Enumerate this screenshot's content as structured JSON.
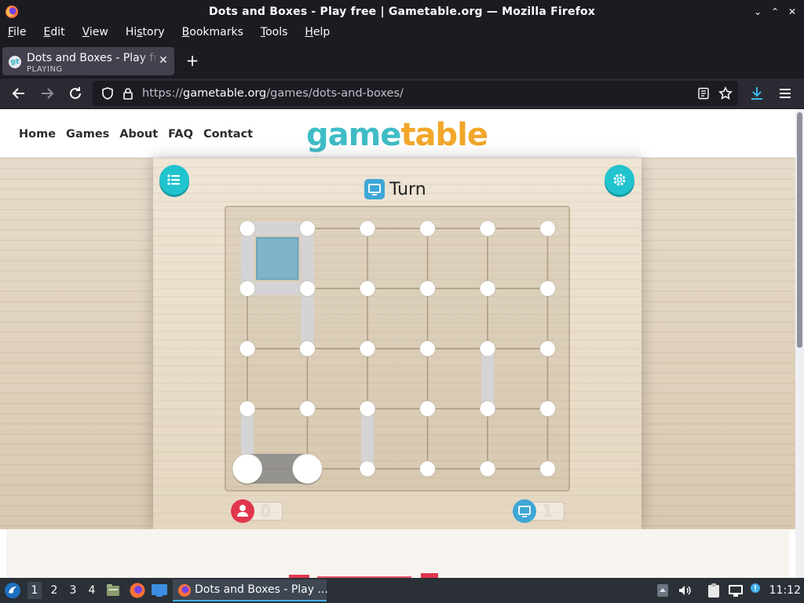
{
  "window": {
    "title": "Dots and Boxes - Play free | Gametable.org — Mozilla Firefox",
    "controls": [
      "⌄",
      "⌃",
      "✕"
    ]
  },
  "menubar": {
    "items": [
      {
        "label": "File",
        "u": "F",
        "rest": "ile"
      },
      {
        "label": "Edit",
        "u": "E",
        "rest": "dit"
      },
      {
        "label": "View",
        "u": "V",
        "rest": "iew"
      },
      {
        "label": "History",
        "u": "",
        "pre": "Hi",
        "mid": "s",
        "rest": "tory"
      },
      {
        "label": "Bookmarks",
        "u": "B",
        "rest": "ookmarks"
      },
      {
        "label": "Tools",
        "u": "T",
        "rest": "ools"
      },
      {
        "label": "Help",
        "u": "H",
        "rest": "elp"
      }
    ]
  },
  "tab": {
    "title": "Dots and Boxes - Play free | Gametable.org",
    "status": "PLAYING",
    "favicon": "gt"
  },
  "navbar": {
    "url_scheme": "https://",
    "url_host": "gametable.org",
    "url_path": "/games/dots-and-boxes/"
  },
  "site": {
    "nav": [
      "Home",
      "Games",
      "About",
      "FAQ",
      "Contact"
    ],
    "logo_part1": "game",
    "logo_part2": "table",
    "turn_label": "Turn",
    "player_score": "0",
    "computer_score": "1",
    "colors": {
      "accent": "#21c3cf",
      "player": "#e0364d",
      "computer": "#3ea7d6",
      "captured_box": "#7fb4c9"
    }
  },
  "board": {
    "rows": 5,
    "cols": 6,
    "drawn_lines": [
      {
        "from": [
          0,
          0
        ],
        "to": [
          0,
          1
        ]
      },
      {
        "from": [
          0,
          0
        ],
        "to": [
          1,
          0
        ]
      },
      {
        "from": [
          0,
          1
        ],
        "to": [
          1,
          1
        ]
      },
      {
        "from": [
          1,
          0
        ],
        "to": [
          1,
          1
        ]
      },
      {
        "from": [
          1,
          1
        ],
        "to": [
          2,
          1
        ]
      },
      {
        "from": [
          2,
          4
        ],
        "to": [
          3,
          4
        ]
      },
      {
        "from": [
          3,
          0
        ],
        "to": [
          4,
          0
        ]
      },
      {
        "from": [
          3,
          2
        ],
        "to": [
          4,
          2
        ]
      },
      {
        "from": [
          4,
          0
        ],
        "to": [
          4,
          1
        ],
        "last_move": true
      }
    ],
    "captured_boxes": [
      {
        "row": 0,
        "col": 0,
        "owner": "computer"
      }
    ]
  },
  "taskbar": {
    "workspaces": [
      "1",
      "2",
      "3",
      "4"
    ],
    "active_workspace": "1",
    "task_label": "Dots and Boxes - Play ...",
    "clock": "11:12"
  }
}
